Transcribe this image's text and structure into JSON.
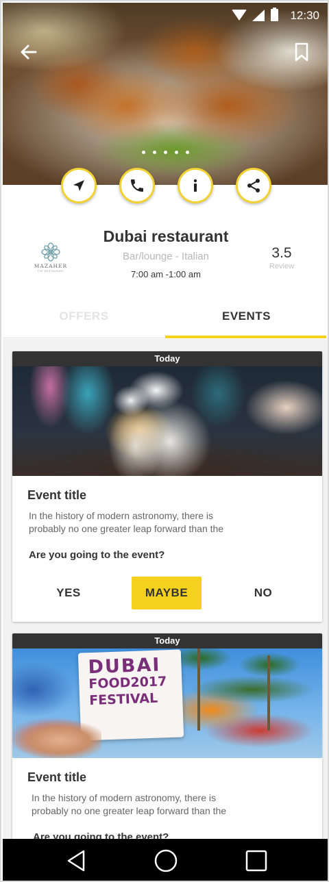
{
  "status_bar": {
    "time": "12:30"
  },
  "hero": {
    "dots_count": 5
  },
  "restaurant": {
    "name": "Dubai restaurant",
    "category": "Bar/lounge - Italian",
    "hours": "7:00 am -1:00 am",
    "rating": "3.5",
    "rating_label": "Review",
    "logo_text": "MAZAHER",
    "logo_subtext": "THE RESTAURANT"
  },
  "tabs": [
    {
      "label": "OFFERS",
      "active": false
    },
    {
      "label": "EVENTS",
      "active": true
    }
  ],
  "events": [
    {
      "badge": "Today",
      "title": "Event title",
      "description_line1": "In the history of modern astronomy, there is",
      "description_line2": "probably no one greater leap forward than the",
      "question": "Are you going to the event?",
      "options": {
        "yes": "YES",
        "maybe": "MAYBE",
        "no": "NO"
      },
      "selected": "MAYBE"
    },
    {
      "badge": "Today",
      "title": "Event title",
      "description_line1": "In the history of modern astronomy, there is",
      "description_line2": "probably no one greater leap forward than the",
      "question": "Are you going to the event?",
      "sign_text": {
        "line1": "DUBAI",
        "line2": "FOOD2017",
        "line3": "FESTIVAL"
      }
    }
  ],
  "colors": {
    "accent": "#f4d11d",
    "badge_bg": "#333333",
    "nav_bg": "#000000"
  },
  "icons": {
    "back": "arrow-left-icon",
    "bookmark": "bookmark-icon",
    "actions": [
      "navigation-icon",
      "phone-icon",
      "info-icon",
      "share-icon"
    ],
    "nav": [
      "back-triangle-icon",
      "home-circle-icon",
      "recents-square-icon"
    ]
  }
}
